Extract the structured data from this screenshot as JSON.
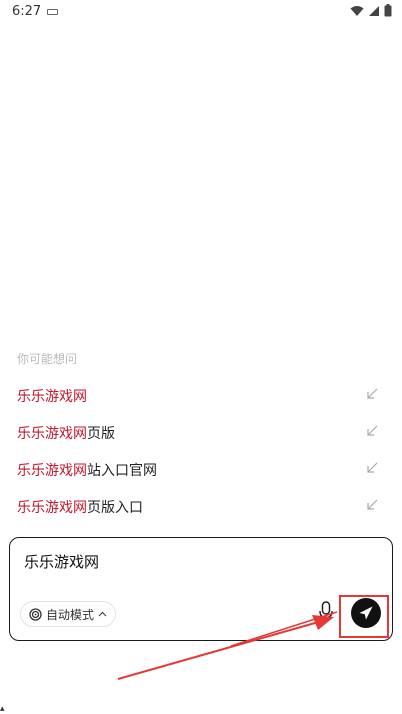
{
  "status_bar": {
    "time": "6:27"
  },
  "suggestions": {
    "header": "你可能想问",
    "items": [
      {
        "highlight": "乐乐游戏网",
        "rest": ""
      },
      {
        "highlight": "乐乐游戏网",
        "rest": "页版"
      },
      {
        "highlight": "乐乐游戏网",
        "rest": "站入口官网"
      },
      {
        "highlight": "乐乐游戏网",
        "rest": "页版入口"
      }
    ]
  },
  "input": {
    "value": "乐乐游戏网"
  },
  "mode_chip": {
    "label": "自动模式"
  },
  "colors": {
    "highlight_text": "#c4162c",
    "annotation_red": "#e53935"
  }
}
